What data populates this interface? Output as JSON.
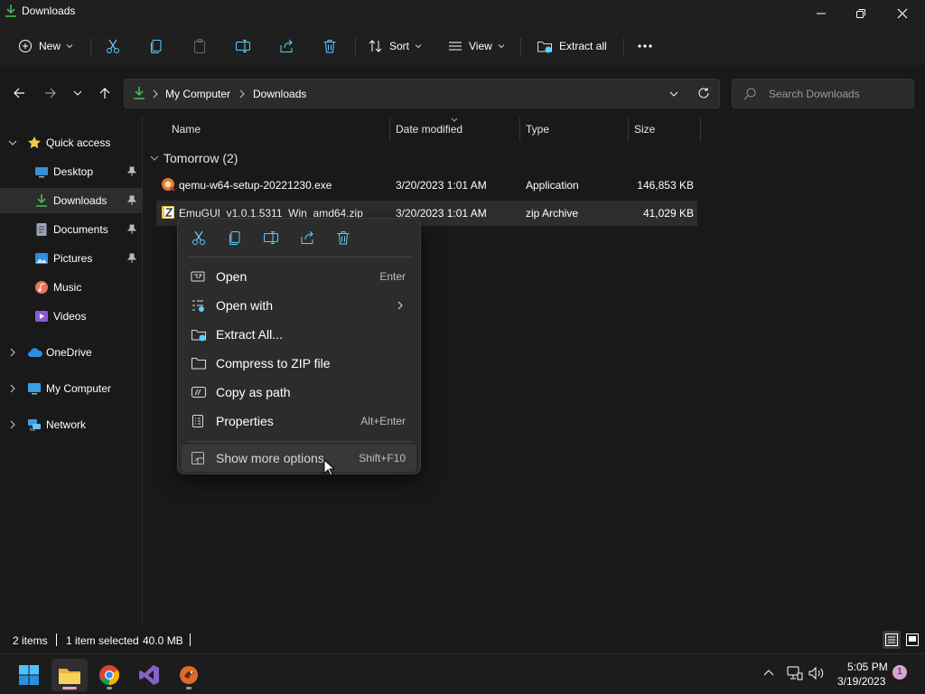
{
  "window": {
    "title": "Downloads"
  },
  "toolbar": {
    "new_label": "New",
    "sort_label": "Sort",
    "view_label": "View",
    "extract_all_label": "Extract all"
  },
  "address": {
    "crumbs": [
      "My Computer",
      "Downloads"
    ],
    "search_placeholder": "Search Downloads"
  },
  "sidebar": {
    "items": [
      {
        "label": "Quick access",
        "icon": "star-icon"
      },
      {
        "label": "Desktop",
        "icon": "desktop-icon",
        "pinned": true
      },
      {
        "label": "Downloads",
        "icon": "download-icon",
        "pinned": true,
        "selected": true
      },
      {
        "label": "Documents",
        "icon": "document-icon",
        "pinned": true
      },
      {
        "label": "Pictures",
        "icon": "pictures-icon",
        "pinned": true
      },
      {
        "label": "Music",
        "icon": "music-icon"
      },
      {
        "label": "Videos",
        "icon": "videos-icon"
      },
      {
        "label": "OneDrive",
        "icon": "cloud-icon"
      },
      {
        "label": "My Computer",
        "icon": "computer-icon"
      },
      {
        "label": "Network",
        "icon": "network-icon"
      }
    ]
  },
  "columns": {
    "name": "Name",
    "date": "Date modified",
    "type": "Type",
    "size": "Size"
  },
  "group": {
    "label": "Tomorrow (2)"
  },
  "files": [
    {
      "name": "qemu-w64-setup-20221230.exe",
      "date": "3/20/2023 1:01 AM",
      "type": "Application",
      "size": "146,853 KB",
      "icon": "installer-icon"
    },
    {
      "name": "EmuGUI_v1.0.1.5311_Win_amd64.zip",
      "date": "3/20/2023 1:01 AM",
      "type": "zip Archive",
      "size": "41,029 KB",
      "icon": "zip-icon",
      "selected": true
    }
  ],
  "context_menu": {
    "items": [
      {
        "label": "Open",
        "shortcut": "Enter",
        "icon": "open-icon"
      },
      {
        "label": "Open with",
        "shortcut": "",
        "icon": "open-with-icon",
        "submenu": true
      },
      {
        "label": "Extract All...",
        "shortcut": "",
        "icon": "extract-icon"
      },
      {
        "label": "Compress to ZIP file",
        "shortcut": "",
        "icon": "compress-icon"
      },
      {
        "label": "Copy as path",
        "shortcut": "",
        "icon": "copy-path-icon"
      },
      {
        "label": "Properties",
        "shortcut": "Alt+Enter",
        "icon": "properties-icon"
      },
      {
        "label": "Show more options",
        "shortcut": "Shift+F10",
        "icon": "more-options-icon",
        "hovered": true
      }
    ]
  },
  "status": {
    "count": "2 items",
    "selection": "1 item selected",
    "size": "40.0 MB"
  },
  "clock": {
    "time": "5:05 PM",
    "date": "3/19/2023"
  },
  "notifications": {
    "count": "1"
  },
  "colors": {
    "accent": "#60cdff",
    "folder": "#f2c94c",
    "download_green": "#3fb950"
  }
}
